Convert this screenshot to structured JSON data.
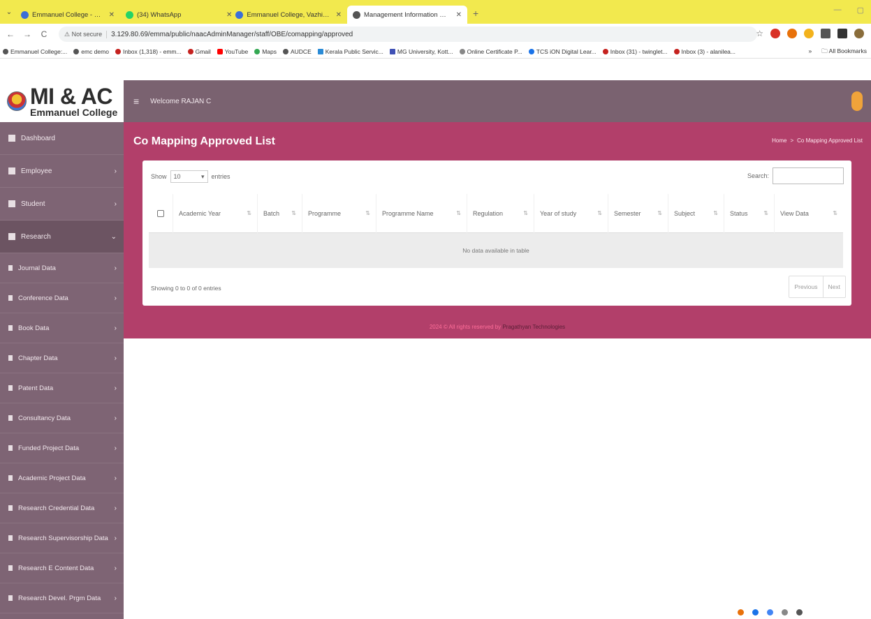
{
  "browser": {
    "tabs": [
      {
        "label": "Emmanuel College - College M",
        "active": false,
        "favicon_color": "#3b6fd8"
      },
      {
        "label": "(34) WhatsApp",
        "active": false,
        "favicon_color": "#25d366"
      },
      {
        "label": "Emmanuel College, Vazhichal",
        "active": false,
        "favicon_color": "#3b6fd8"
      },
      {
        "label": "Management Information and",
        "active": true,
        "favicon_color": "#555555"
      }
    ],
    "new_tab": "+",
    "url_badge": "Not secure",
    "url": "3.129.80.69/emma/public/naacAdminManager/staff/OBE/comapping/approved",
    "bookmarks": [
      "Emmanuel College:...",
      "emc demo",
      "Inbox (1,318) - emm...",
      "Gmail",
      "YouTube",
      "Maps",
      "AUDCE",
      "Kerala Public Servic...",
      "MG University, Kott...",
      "Online Certificate P...",
      "TCS iON Digital Lear...",
      "Inbox (31) - twinglet...",
      "Inbox (3) - alanilea..."
    ],
    "bookmarks_more": "»",
    "all_bookmarks": "All Bookmarks"
  },
  "brand": {
    "title": "MI & AC",
    "subtitle": "Emmanuel College"
  },
  "topbar": {
    "welcome": "Welcome RAJAN C"
  },
  "sidebar": {
    "items": [
      {
        "label": "Dashboard",
        "chevron": ""
      },
      {
        "label": "Employee",
        "chevron": "›"
      },
      {
        "label": "Student",
        "chevron": "›"
      },
      {
        "label": "Research",
        "chevron": "⌄"
      }
    ],
    "sub_items": [
      "Journal Data",
      "Conference Data",
      "Book Data",
      "Chapter Data",
      "Patent Data",
      "Consultancy Data",
      "Funded Project Data",
      "Academic Project Data",
      "Research Credential Data",
      "Research Supervisorship Data",
      "Research E Content Data",
      "Research Devel. Prgm Data"
    ]
  },
  "page": {
    "title": "Co Mapping Approved List",
    "breadcrumb": [
      "Home",
      ">",
      "Co Mapping Approved List"
    ]
  },
  "table": {
    "show_label": "Show",
    "length_value": "10",
    "entries_label": "entries",
    "search_label": "Search:",
    "columns": [
      "Academic Year",
      "Batch",
      "Programme",
      "Programme Name",
      "Regulation",
      "Year of study",
      "Semester",
      "Subject",
      "Status",
      "View Data"
    ],
    "empty_message": "No data available in table",
    "info": "Showing 0 to 0 of 0 entries",
    "previous": "Previous",
    "next": "Next"
  },
  "footer": {
    "text": "2024 © All rights reserved by",
    "company": "Pragathyan Technologies"
  },
  "colors": {
    "accent": "#b23f6a",
    "sidebar": "#7e6474",
    "topbar": "#7a6270",
    "chrome_tabbar": "#f2e94e"
  }
}
